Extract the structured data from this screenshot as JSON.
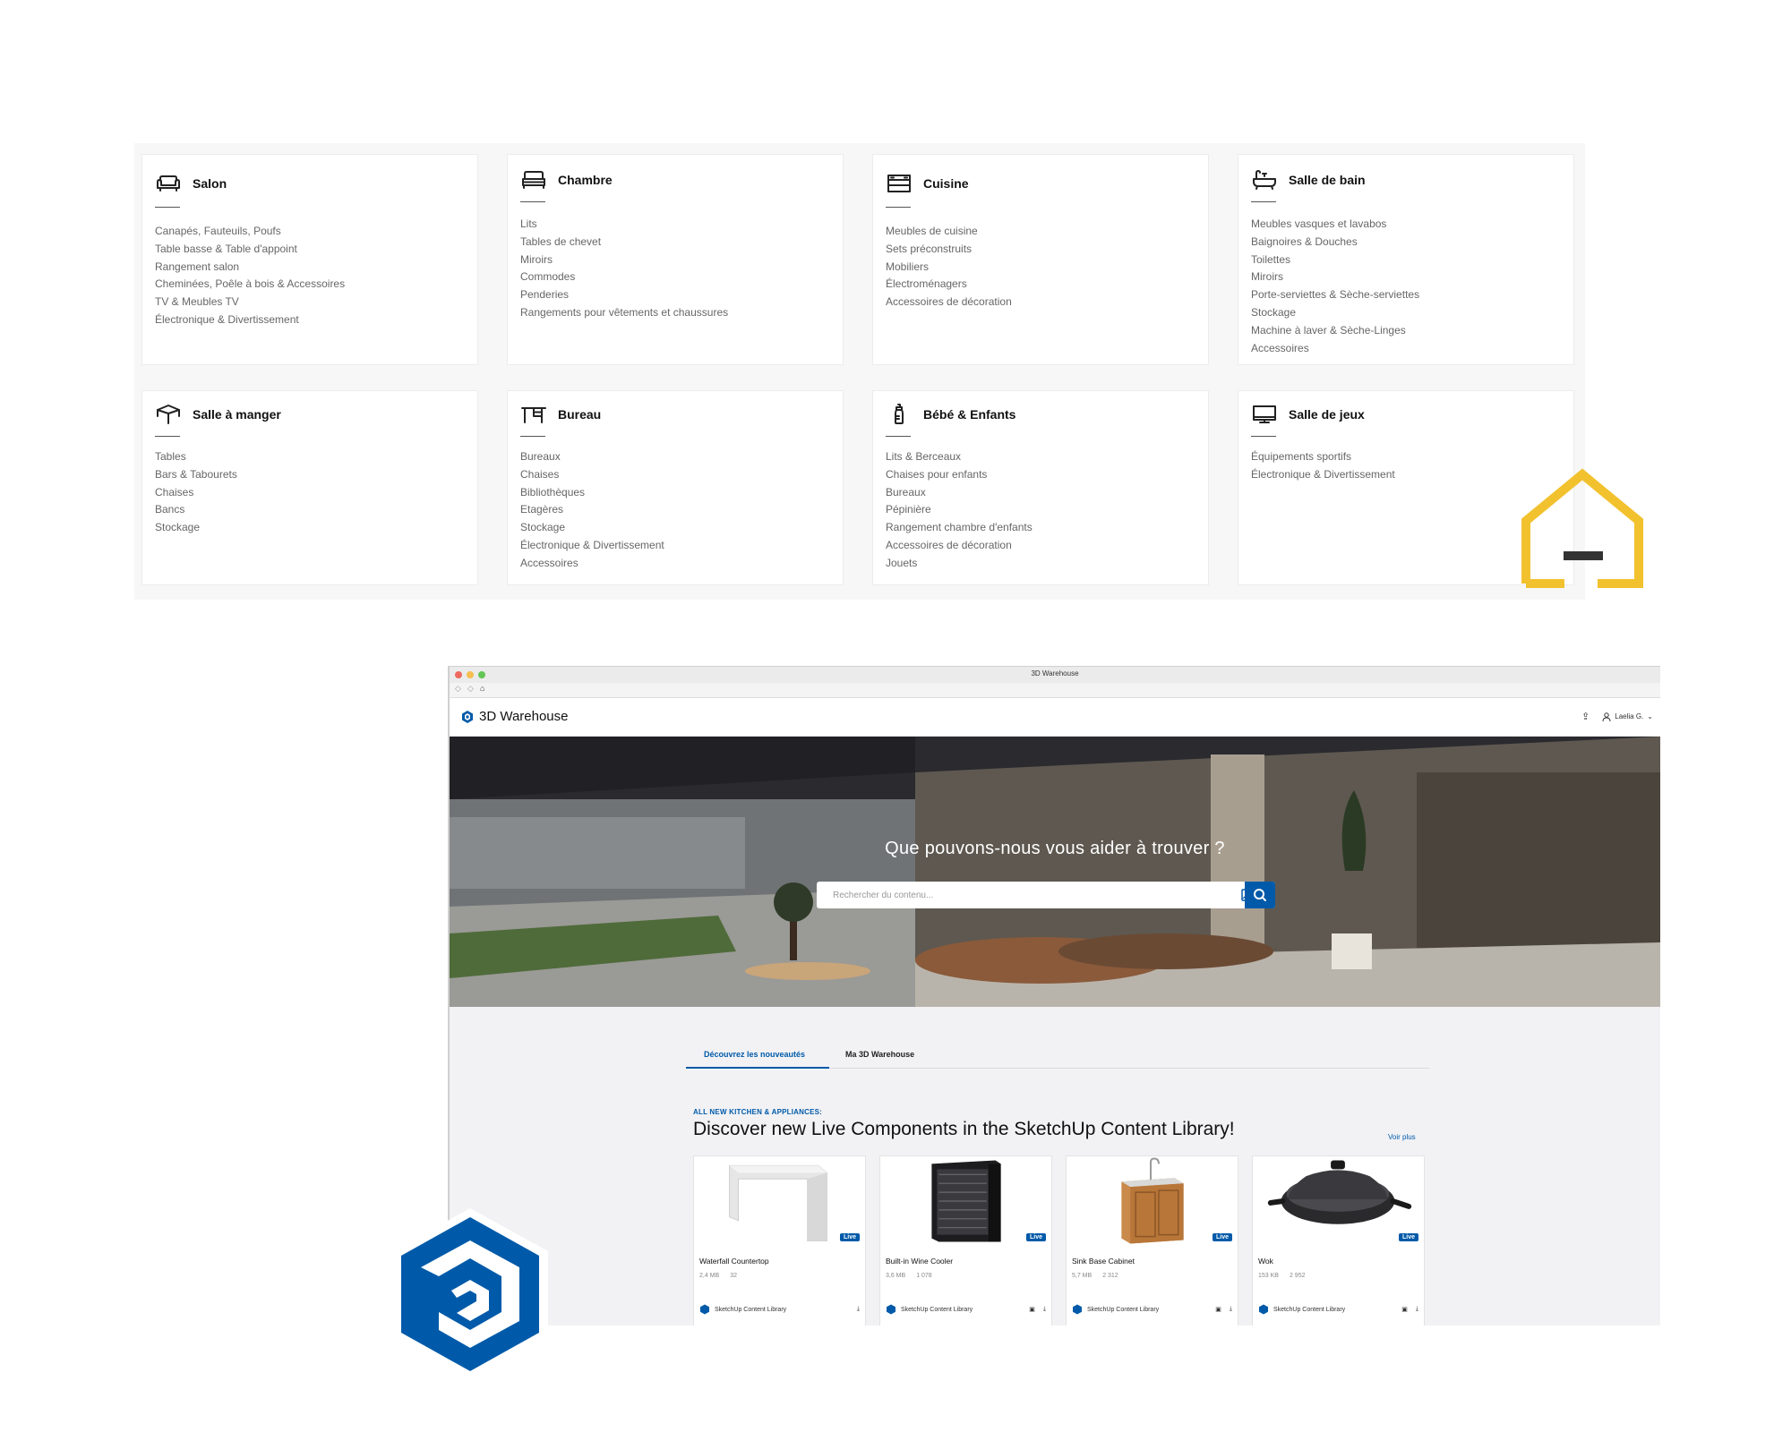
{
  "categories": [
    {
      "title": "Salon",
      "icon": "sofa-icon",
      "items": [
        "Canapés, Fauteuils, Poufs",
        "Table basse & Table d'appoint",
        "Rangement salon",
        "Cheminées, Poêle à bois & Accessoires",
        "TV & Meubles TV",
        "Électronique & Divertissement"
      ]
    },
    {
      "title": "Chambre",
      "icon": "bed-icon",
      "items": [
        "Lits",
        "Tables de chevet",
        "Miroirs",
        "Commodes",
        "Penderies",
        "Rangements pour vêtements et chaussures"
      ]
    },
    {
      "title": "Cuisine",
      "icon": "kitchen-icon",
      "items": [
        "Meubles de cuisine",
        "Sets préconstruits",
        "Mobiliers",
        "Électroménagers",
        "Accessoires de décoration"
      ]
    },
    {
      "title": "Salle de bain",
      "icon": "bathtub-icon",
      "items": [
        "Meubles vasques et lavabos",
        "Baignoires & Douches",
        "Toilettes",
        "Miroirs",
        "Porte-serviettes & Sèche-serviettes",
        "Stockage",
        "Machine à laver & Sèche-Linges",
        "Accessoires"
      ]
    },
    {
      "title": "Salle à manger",
      "icon": "table-icon",
      "items": [
        "Tables",
        "Bars & Tabourets",
        "Chaises",
        "Bancs",
        "Stockage"
      ]
    },
    {
      "title": "Bureau",
      "icon": "desk-icon",
      "items": [
        "Bureaux",
        "Chaises",
        "Bibliothèques",
        "Etagères",
        "Stockage",
        "Électronique & Divertissement",
        "Accessoires"
      ]
    },
    {
      "title": "Bébé & Enfants",
      "icon": "baby-bottle-icon",
      "items": [
        "Lits & Berceaux",
        "Chaises pour enfants",
        "Bureaux",
        "Pépinière",
        "Rangement chambre d'enfants",
        "Accessoires de décoration",
        "Jouets"
      ]
    },
    {
      "title": "Salle de jeux",
      "icon": "monitor-icon",
      "items": [
        "Équipements sportifs",
        "Électronique & Divertissement"
      ]
    }
  ],
  "window": {
    "title": "3D Warehouse"
  },
  "app": {
    "brand": "3D Warehouse",
    "user": "Laelia G."
  },
  "hero": {
    "title": "Que pouvons-nous vous aider à trouver ?",
    "search_placeholder": "Rechercher du contenu..."
  },
  "tabs": [
    {
      "label": "Découvrez les nouveautés",
      "active": true
    },
    {
      "label": "Ma 3D Warehouse",
      "active": false
    }
  ],
  "section": {
    "kicker": "ALL NEW KITCHEN & APPLIANCES:",
    "title": "Discover new Live Components in the SketchUp Content Library!",
    "more": "Voir plus"
  },
  "products": [
    {
      "name": "Waterfall Countertop",
      "size": "2,4 MB",
      "count": "32",
      "badge": "Live",
      "library": "SketchUp Content Library"
    },
    {
      "name": "Built-in Wine Cooler",
      "size": "3,6 MB",
      "count": "1 078",
      "badge": "Live",
      "library": "SketchUp Content Library"
    },
    {
      "name": "Sink Base Cabinet",
      "size": "5,7 MB",
      "count": "2 312",
      "badge": "Live",
      "library": "SketchUp Content Library"
    },
    {
      "name": "Wok",
      "size": "153 KB",
      "count": "2 952",
      "badge": "Live",
      "library": "SketchUp Content Library"
    }
  ],
  "colors": {
    "accent": "#005aa9",
    "logo_yellow": "#f2c12e",
    "logo_blue": "#005aa9"
  }
}
